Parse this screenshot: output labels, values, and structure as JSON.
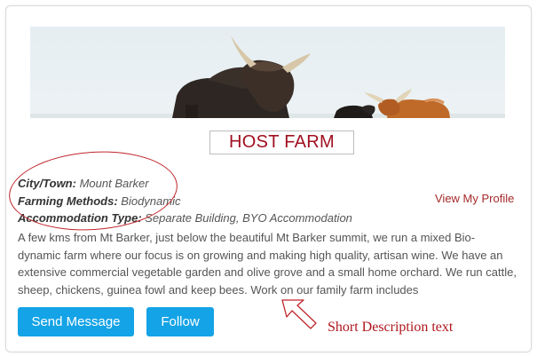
{
  "card": {
    "title": "HOST FARM",
    "fields": [
      {
        "label": "City/Town:",
        "value": "Mount Barker"
      },
      {
        "label": "Farming Methods:",
        "value": "Biodynamic"
      },
      {
        "label": "Accommodation Type:",
        "value": "Separate Building, BYO Accommodation"
      }
    ],
    "view_profile_label": "View My Profile",
    "description": "A few kms from Mt Barker, just below the beautiful Mt Barker summit, we run a mixed Bio-dynamic farm where our focus is on growing and making high quality, artisan wine. We have an extensive commercial vegetable garden and olive grove and a small home orchard. We run cattle, sheep, chickens, guinea fowl and keep bees. Work on our family farm includes",
    "buttons": {
      "send_message": "Send Message",
      "follow": "Follow"
    },
    "banner_image": "highland-cattle-photo"
  },
  "annotation": {
    "label": "Short Description text",
    "color": "#b0151d"
  },
  "colors": {
    "button": "#14a3e6",
    "title": "#a01020",
    "link": "#a52a2a"
  }
}
